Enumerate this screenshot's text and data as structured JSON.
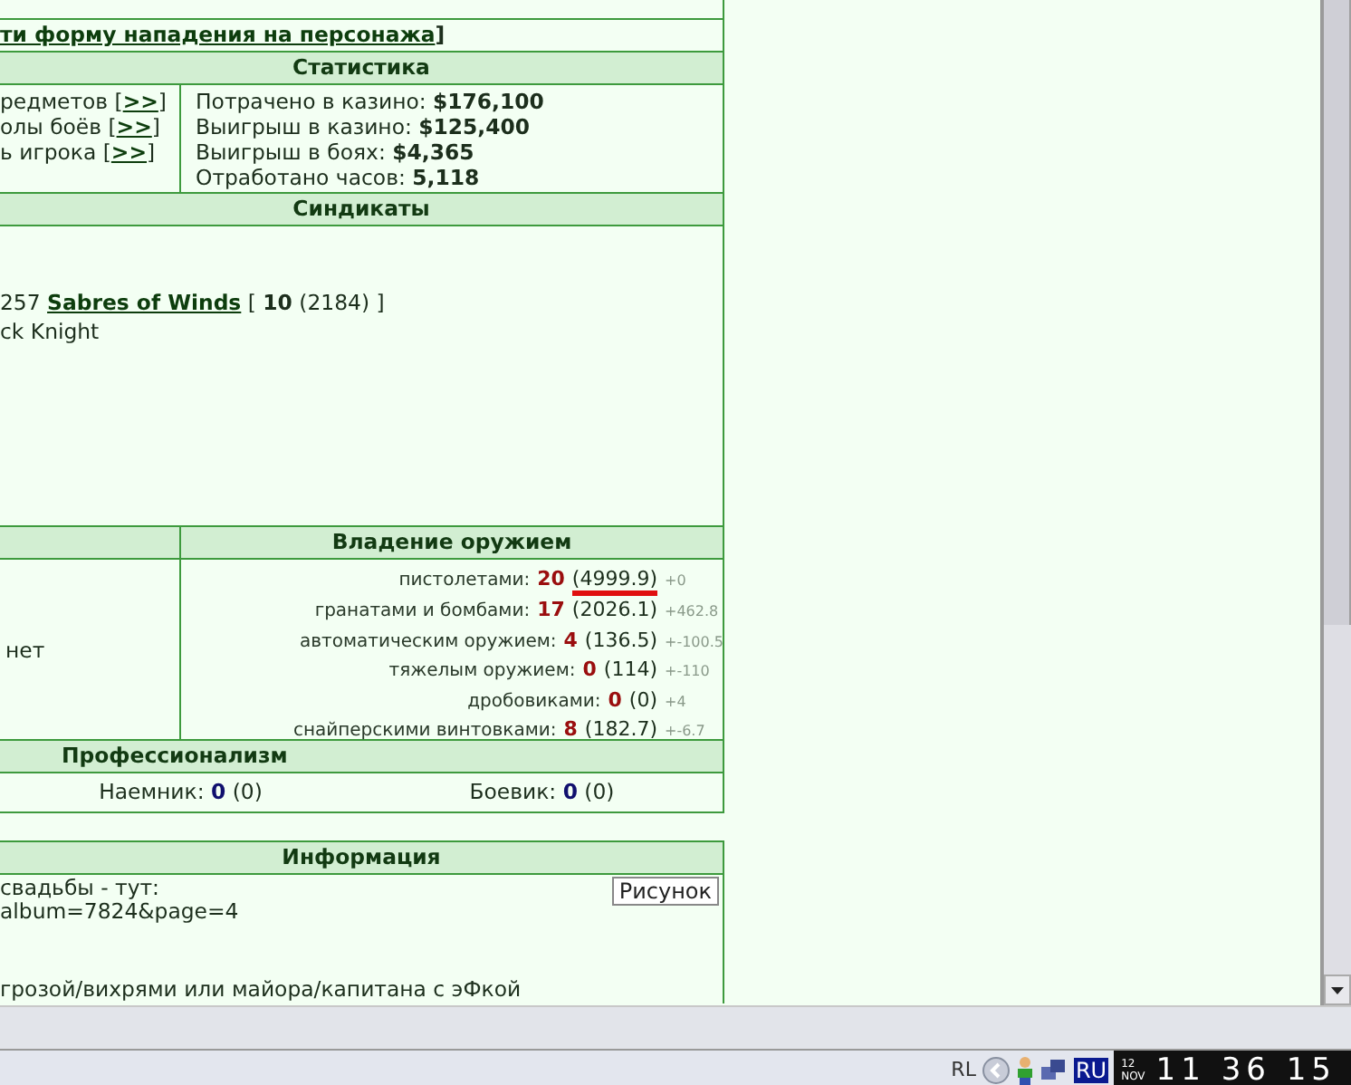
{
  "attack_link": {
    "text": "ти форму нападения на персонажа",
    "suffix": "]"
  },
  "stats": {
    "title": "Статистика",
    "links": [
      {
        "label": "редметов",
        "open": "[",
        "button": ">>",
        "close": "]"
      },
      {
        "label": "олы боёв",
        "open": "[",
        "button": ">>",
        "close": "]"
      },
      {
        "label": "ь игрока",
        "open": "[",
        "button": ">>",
        "close": "]"
      }
    ],
    "items": [
      {
        "label": "Потрачено в казино:",
        "value": "$176,100"
      },
      {
        "label": "Выигрыш в казино:",
        "value": "$125,400"
      },
      {
        "label": "Выигрыш в боях:",
        "value": "$4,365"
      },
      {
        "label": "Отработано часов:",
        "value": "5,118"
      }
    ]
  },
  "syndicates": {
    "title": "Синдикаты",
    "prefix": "257",
    "name": "Sabres of Winds",
    "rest": "[ **10** (2184) ]",
    "second_line": "ck Knight"
  },
  "weapons": {
    "title": "Владение оружием",
    "left": "нет",
    "rows": [
      {
        "label": "пистолетами:",
        "level_text": "20",
        "exp": "(4999.9)",
        "delta": "+0",
        "marked": true
      },
      {
        "label": "гранатами и бомбами:",
        "level_text": "17",
        "exp": "(2026.1)",
        "delta": "+462.8",
        "marked": false
      },
      {
        "label": "автоматическим оружием:",
        "level_text": "4",
        "exp": "(136.5)",
        "delta": "+-100.5",
        "marked": false
      },
      {
        "label": "тяжелым оружием:",
        "level_text": "0",
        "exp": "(114)",
        "delta": "+-110",
        "marked": false
      },
      {
        "label": "дробовиками:",
        "level_text": "0",
        "exp": "(0)",
        "delta": "+4",
        "marked": false
      },
      {
        "label": "снайперскими винтовками:",
        "level_text": "8",
        "exp": "(182.7)",
        "delta": "+-6.7",
        "marked": false
      }
    ]
  },
  "professionalism": {
    "title": "Профессионализм",
    "items": [
      {
        "label": "Наемник:",
        "value": "0",
        "extra": "(0)"
      },
      {
        "label": "Боевик:",
        "value": "0",
        "extra": "(0)"
      }
    ]
  },
  "info": {
    "title": "Информация",
    "lines": [
      "свадьбы - тут:",
      "album=7824&page=4"
    ],
    "footer_line": "грозой/вихрями или майора/капитана с эФкой",
    "button": "Рисунок"
  },
  "taskbar": {
    "tray_lang": "RL",
    "lang": "RU",
    "date_day": "12",
    "date_month": "NOV",
    "time": "11 36 15"
  }
}
